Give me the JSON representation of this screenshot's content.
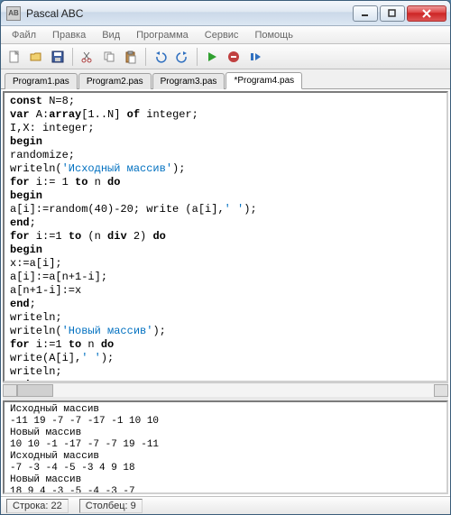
{
  "window": {
    "title": "Pascal ABC",
    "icon_label": "AB"
  },
  "menu": {
    "items": [
      "Файл",
      "Правка",
      "Вид",
      "Программа",
      "Сервис",
      "Помощь"
    ]
  },
  "toolbar": {
    "new": "new",
    "open": "open",
    "save": "save",
    "cut": "cut",
    "copy": "copy",
    "paste": "paste",
    "undo": "undo",
    "redo": "redo",
    "run": "run",
    "stop": "stop",
    "step": "step"
  },
  "tabs": {
    "items": [
      "Program1.pas",
      "Program2.pas",
      "Program3.pas",
      "*Program4.pas"
    ],
    "active": 3
  },
  "code": {
    "l1_kw": "const",
    "l1_rest": " N=8;",
    "l2_kw": "var",
    "l2_rest1": " A:",
    "l2_kw2": "array",
    "l2_rest2": "[1..N] ",
    "l2_kw3": "of",
    "l2_rest3": " integer;",
    "l3": "I,X: integer;",
    "l4": "begin",
    "l5": "randomize;",
    "l6a": "writeln(",
    "l6s": "'Исходный массив'",
    "l6b": ");",
    "l7_kw1": "for",
    "l7_a": " i:= 1 ",
    "l7_kw2": "to",
    "l7_b": " n ",
    "l7_kw3": "do",
    "l8": "begin",
    "l9a": "a[i]:=random(40)-20; write (a[i],",
    "l9s": "' '",
    "l9b": ");",
    "l10": "end",
    "l10s": ";",
    "l11_kw1": "for",
    "l11_a": " i:=1 ",
    "l11_kw2": "to",
    "l11_b": " (n ",
    "l11_kw3": "div",
    "l11_c": " 2) ",
    "l11_kw4": "do",
    "l12": "begin",
    "l13": "x:=a[i];",
    "l14": "a[i]:=a[n+1-i];",
    "l15": "a[n+1-i]:=x",
    "l16": "end",
    "l16s": ";",
    "l17": "writeln;",
    "l18a": "writeln(",
    "l18s": "'Новый массив'",
    "l18b": ");",
    "l19_kw1": "for",
    "l19_a": " i:=1 ",
    "l19_kw2": "to",
    "l19_b": " n ",
    "l19_kw3": "do",
    "l20a": "write(A[i],",
    "l20s": "' '",
    "l20b": ");",
    "l21": "writeln;",
    "l22": "end",
    "l22s": "."
  },
  "output": {
    "l1": "Исходный массив",
    "l2": "-11 19 -7 -7 -17 -1 10 10",
    "l3": "Новый массив",
    "l4": "10 10 -1 -17 -7 -7 19 -11",
    "l5": "Исходный массив",
    "l6": "-7 -3 -4 -5 -3 4 9 18",
    "l7": "Новый массив",
    "l8": "18 9 4 -3 -5 -4 -3 -7"
  },
  "status": {
    "line_label": "Строка:",
    "line_val": "22",
    "col_label": "Столбец:",
    "col_val": "9"
  }
}
